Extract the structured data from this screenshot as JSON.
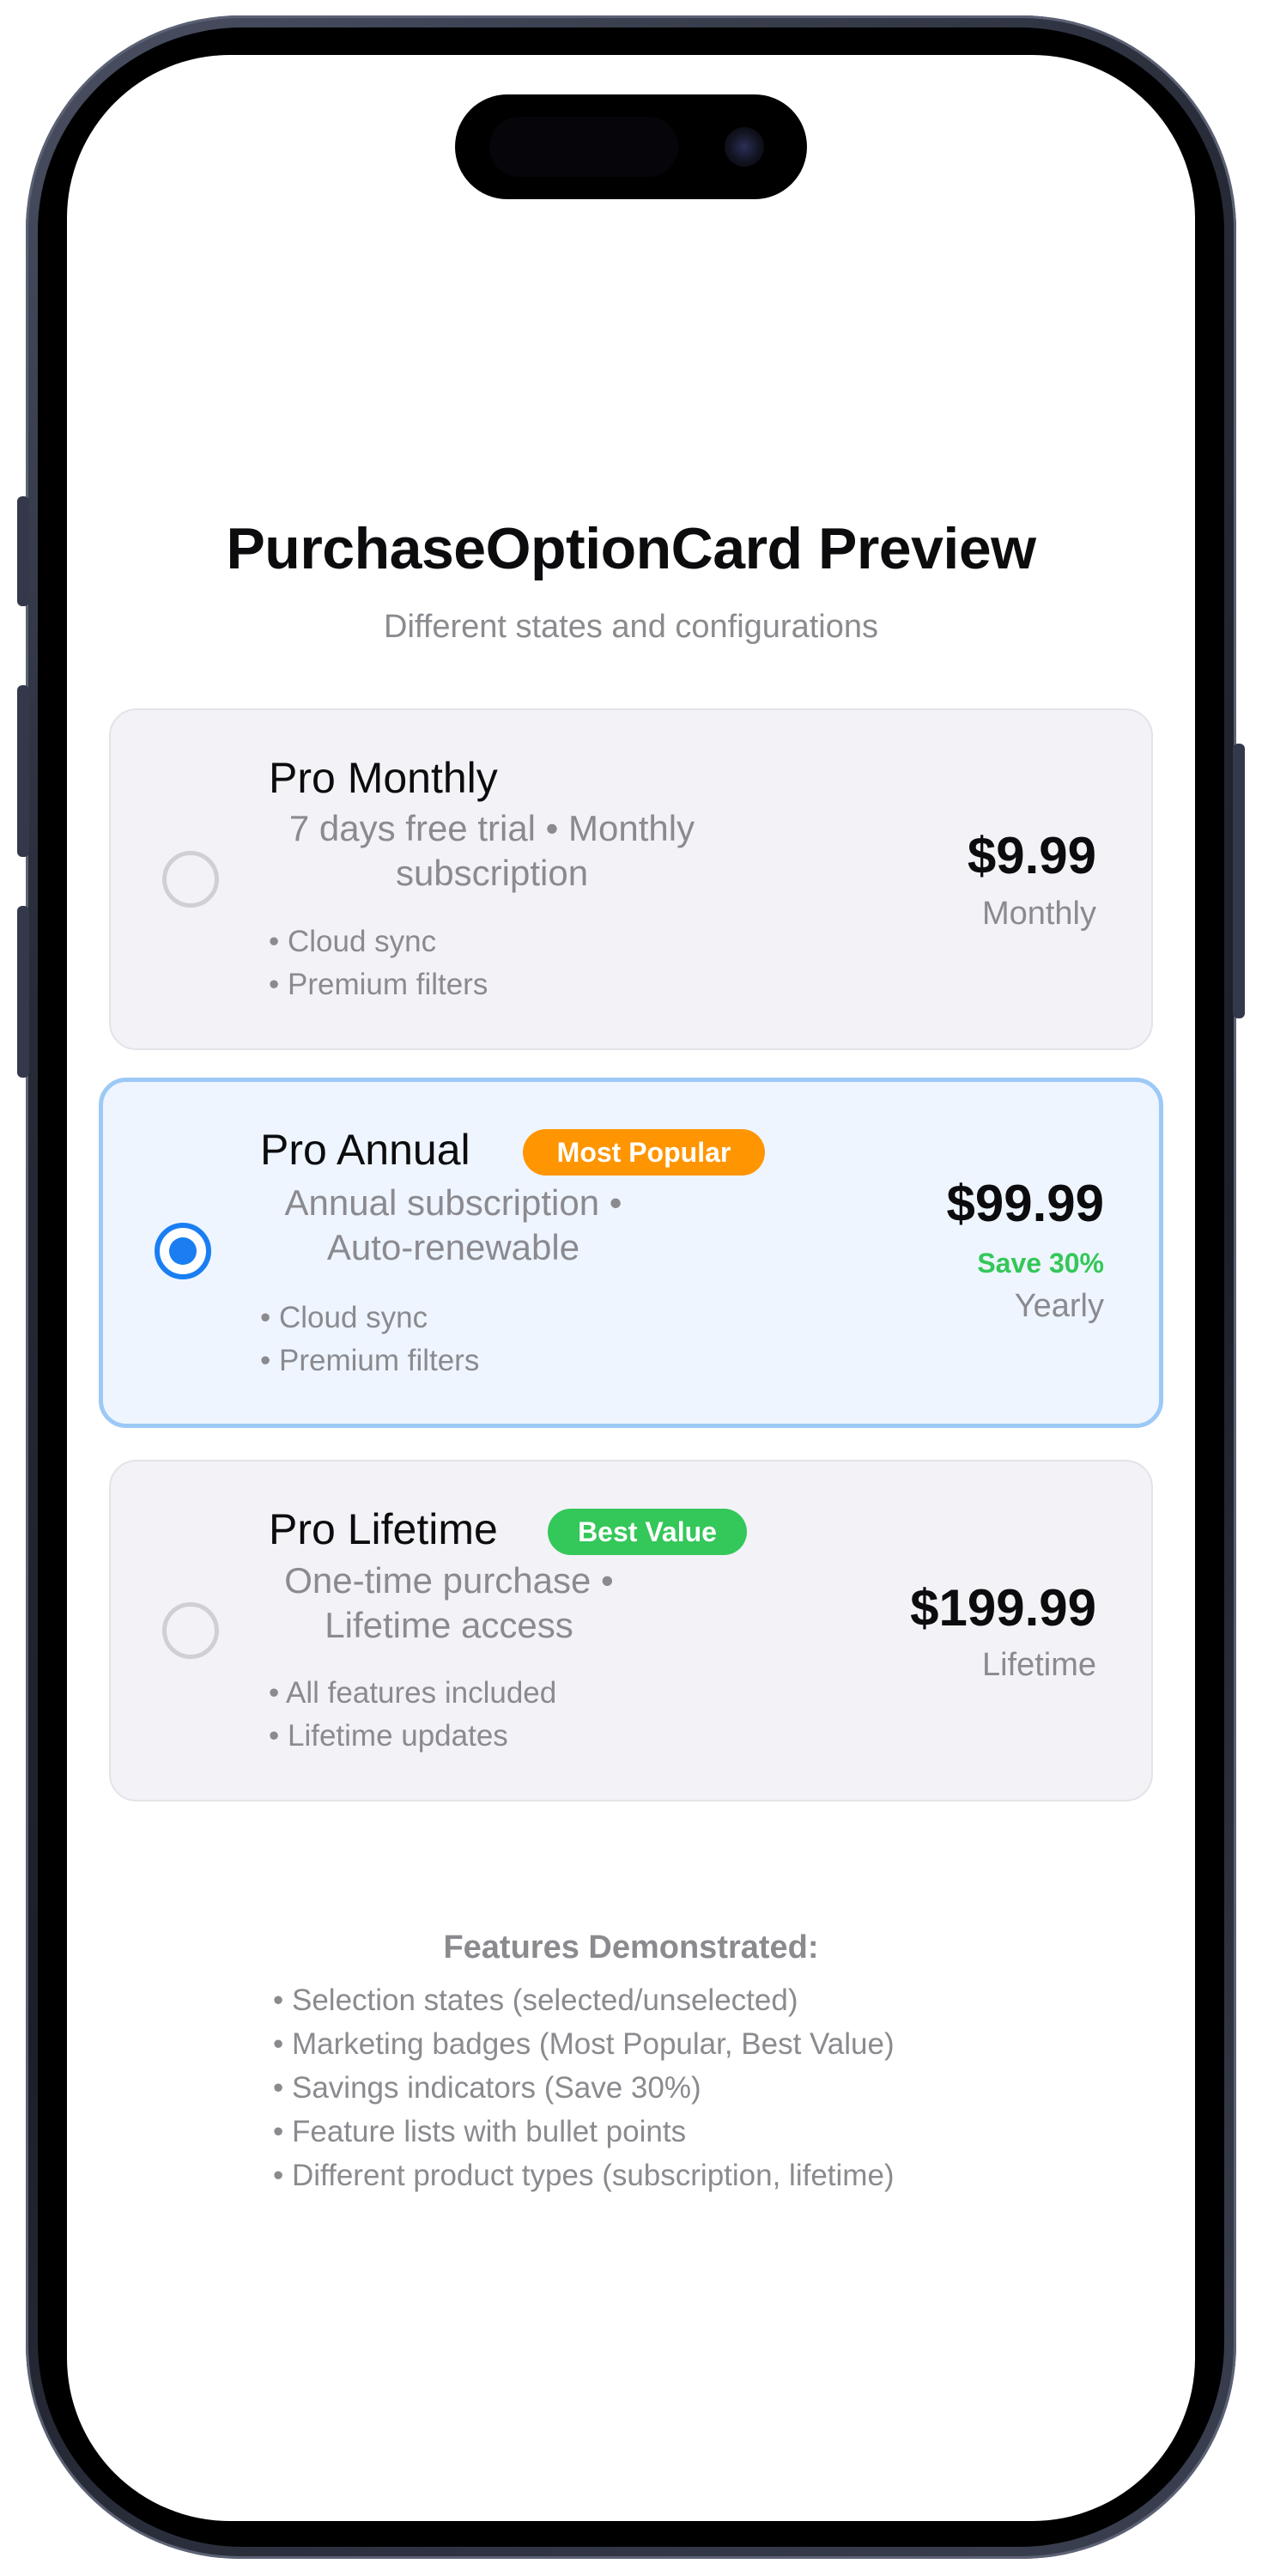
{
  "header": {
    "title": "PurchaseOptionCard Preview",
    "subtitle": "Different states and configurations"
  },
  "colors": {
    "accent": "#1a7ef2",
    "badge_popular": "#ff9500",
    "badge_value": "#34c759",
    "savings": "#34c759"
  },
  "options": [
    {
      "name": "Pro Monthly",
      "selected": false,
      "badge": "",
      "description_line1": "7 days free trial • Monthly",
      "description_line2": "subscription",
      "features": [
        "• Cloud sync",
        "• Premium filters"
      ],
      "price": "$9.99",
      "savings": "",
      "period": "Monthly"
    },
    {
      "name": "Pro Annual",
      "selected": true,
      "badge": "Most Popular",
      "description_line1": "Annual subscription •",
      "description_line2": "Auto-renewable",
      "features": [
        "• Cloud sync",
        "• Premium filters"
      ],
      "price": "$99.99",
      "savings": "Save 30%",
      "period": "Yearly"
    },
    {
      "name": "Pro Lifetime",
      "selected": false,
      "badge": "Best Value",
      "description_line1": "One-time purchase •",
      "description_line2": "Lifetime access",
      "features": [
        "• All features included",
        "• Lifetime updates"
      ],
      "price": "$199.99",
      "savings": "",
      "period": "Lifetime"
    }
  ],
  "features_section": {
    "title": "Features Demonstrated:",
    "items": [
      "• Selection states (selected/unselected)",
      "• Marketing badges (Most Popular, Best Value)",
      "• Savings indicators (Save 30%)",
      "• Feature lists with bullet points",
      "• Different product types (subscription, lifetime)"
    ]
  }
}
